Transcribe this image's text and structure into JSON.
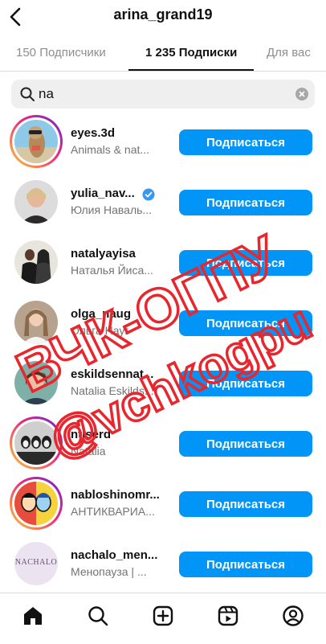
{
  "header": {
    "title": "arina_grand19"
  },
  "tabs": [
    {
      "label": "150 Подписчики"
    },
    {
      "label": "1 235 Подписки"
    },
    {
      "label": "Для вас"
    }
  ],
  "search": {
    "value": "na"
  },
  "users": [
    {
      "username": "eyes.3d",
      "fullname": "Animals & nat...",
      "button": "Подписаться"
    },
    {
      "username": "yulia_nav...",
      "fullname": "Юлия Наваль...",
      "button": "Подписаться",
      "verified": true
    },
    {
      "username": "natalyayisa",
      "fullname": "Наталья Йиса...",
      "button": "Подписаться"
    },
    {
      "username": "olga_naug",
      "fullname": "Ольга Науг",
      "button": "Подписаться"
    },
    {
      "username": "eskildsennat...",
      "fullname": "Natalia Eskilds...",
      "button": "Подписаться"
    },
    {
      "username": "ntlserd",
      "fullname": "Natalia",
      "button": "Подписаться"
    },
    {
      "username": "nabloshinomr...",
      "fullname": "АНТИКВАРИА...",
      "button": "Подписаться"
    },
    {
      "username": "nachalo_men...",
      "fullname": "Менопауза | ...",
      "button": "Подписаться",
      "avatar_text": "NACHALO"
    }
  ],
  "watermark": {
    "line1": "ВЧК-ОГПУ",
    "line2": "@vchkogpu",
    "color": "#e8262e"
  },
  "colors": {
    "accent": "#0095f6"
  },
  "bottom_nav": [
    "home-icon",
    "search-icon",
    "create-icon",
    "reels-icon",
    "profile-icon"
  ]
}
